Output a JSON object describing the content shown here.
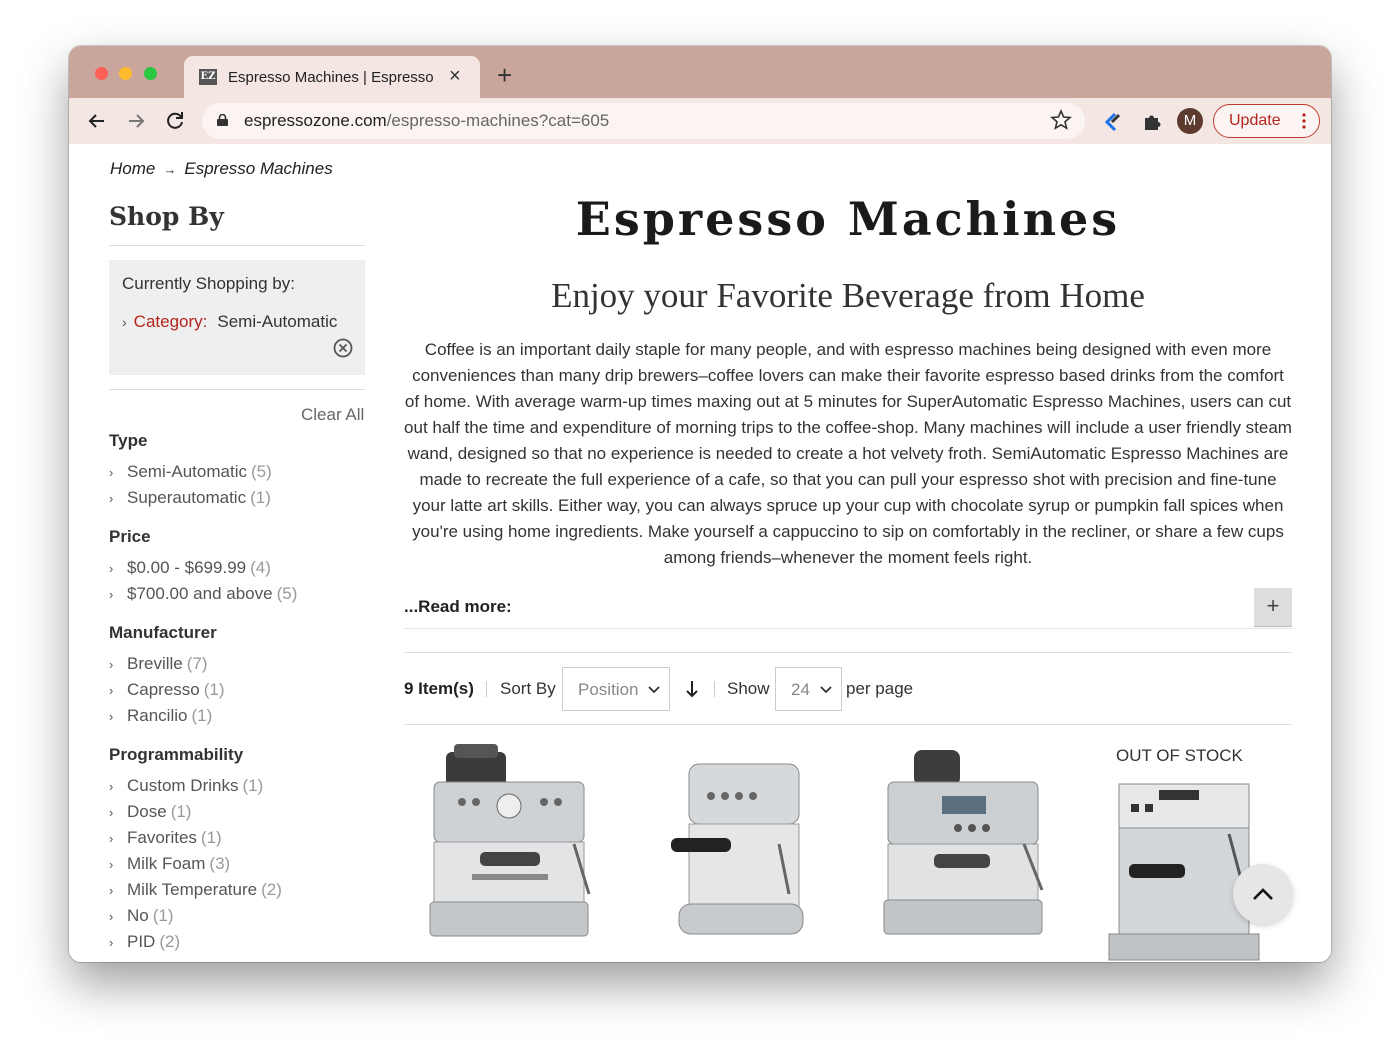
{
  "browser": {
    "tab_title": "Espresso Machines | Espresso",
    "favicon_text": "EZ",
    "url_domain": "espressozone.com",
    "url_path": "/espresso-machines?cat=605",
    "profile_initial": "M",
    "update_label": "Update"
  },
  "breadcrumb": {
    "home": "Home",
    "separator": "→",
    "current": "Espresso Machines"
  },
  "sidebar": {
    "title": "Shop By",
    "current": {
      "title": "Currently Shopping by:",
      "chevron": "›",
      "filter_label": "Category:",
      "filter_value": "Semi-Automatic"
    },
    "clear_all": "Clear All",
    "groups": [
      {
        "title": "Type",
        "items": [
          {
            "label": "Semi-Automatic",
            "count": "(5)"
          },
          {
            "label": "Superautomatic",
            "count": "(1)"
          }
        ]
      },
      {
        "title": "Price",
        "items": [
          {
            "label": "$0.00 - $699.99",
            "count": "(4)"
          },
          {
            "label": "$700.00 and above",
            "count": "(5)"
          }
        ]
      },
      {
        "title": "Manufacturer",
        "items": [
          {
            "label": "Breville",
            "count": "(7)"
          },
          {
            "label": "Capresso",
            "count": "(1)"
          },
          {
            "label": "Rancilio",
            "count": "(1)"
          }
        ]
      },
      {
        "title": "Programmability",
        "items": [
          {
            "label": "Custom Drinks",
            "count": "(1)"
          },
          {
            "label": "Dose",
            "count": "(1)"
          },
          {
            "label": "Favorites",
            "count": "(1)"
          },
          {
            "label": "Milk Foam",
            "count": "(3)"
          },
          {
            "label": "Milk Temperature",
            "count": "(2)"
          },
          {
            "label": "No",
            "count": "(1)"
          },
          {
            "label": "PID",
            "count": "(2)"
          }
        ]
      }
    ]
  },
  "main": {
    "title": "Espresso Machines",
    "subtitle": "Enjoy your Favorite Beverage from Home",
    "description": "Coffee is an important daily staple for many people, and with espresso machines being designed with even more conveniences than many drip brewers–coffee lovers can make their favorite espresso based drinks from the comfort of home. With average warm-up times maxing out at 5 minutes for SuperAutomatic Espresso Machines, users can cut out half the time and expenditure of morning trips to the coffee-shop. Many machines will include a user friendly steam wand, designed so that no experience is needed to create a hot velvety froth. SemiAutomatic Espresso Machines are made to recreate the full experience of a cafe, so that you can pull your espresso shot with precision and fine-tune your latte art skills. Either way, you can always spruce up your cup with chocolate syrup or pumpkin fall spices when you're using home ingredients. Make yourself a cappuccino to sip on comfortably in the recliner, or share a few cups among friends–whenever the moment feels right.",
    "read_more": "...Read more:",
    "expand_symbol": "+",
    "toolbar": {
      "items_count": "9 Item(s)",
      "sort_label": "Sort By",
      "sort_value": "Position",
      "show_label": "Show",
      "limit_value": "24",
      "per_page": "per page"
    },
    "products": [
      {
        "stock_label": ""
      },
      {
        "stock_label": ""
      },
      {
        "stock_label": ""
      },
      {
        "stock_label": "OUT OF STOCK"
      }
    ]
  },
  "colors": {
    "tabbar": "#c9a59c",
    "toolbar": "#f3e6e3",
    "accent_red": "#b3261e"
  }
}
